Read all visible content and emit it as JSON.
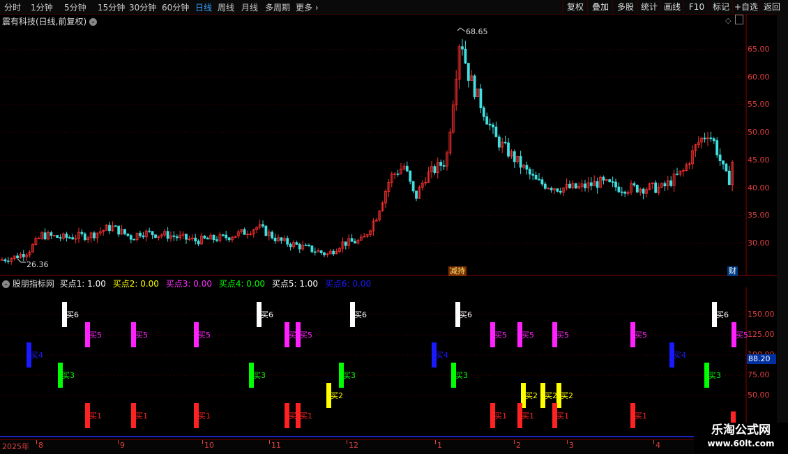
{
  "toolbar": {
    "periods": [
      "分时",
      "1分钟",
      "5分钟",
      "15分钟",
      "30分钟",
      "60分钟",
      "日线",
      "周线",
      "月线",
      "多周期",
      "更多"
    ],
    "active_period": "日线",
    "more_chevron_icon": "chevron-right",
    "buttons": [
      "复权",
      "叠加",
      "多股",
      "统计",
      "画线",
      "F10",
      "标记",
      "+自选",
      "返回"
    ]
  },
  "main_chart": {
    "title": "震有科技(日线,前复权)",
    "title_icon": "chevron-down-circle",
    "max_label": "68.65",
    "min_label": "26.36",
    "y_ticks": [
      "65.00",
      "60.00",
      "55.00",
      "50.00",
      "45.00",
      "40.00",
      "35.00",
      "30.00"
    ],
    "badge_left": "减持",
    "badge_right": "财",
    "colors": {
      "up": "#ff3030",
      "down": "#40e0e0",
      "grid": "#5a0000"
    }
  },
  "indicator": {
    "name": "股朋指标网",
    "params": [
      {
        "label": "买点1: 1.00",
        "color": "#ffffff"
      },
      {
        "label": "买点2: 0.00",
        "color": "#ffff00"
      },
      {
        "label": "买点3: 0.00",
        "color": "#ff33ff"
      },
      {
        "label": "买点4: 0.00",
        "color": "#00ff00"
      },
      {
        "label": "买点5: 1.00",
        "color": "#ffffff"
      },
      {
        "label": "买点6: 0.00",
        "color": "#1a1aff"
      }
    ],
    "y_ticks": [
      "150.00",
      "125.00",
      "100.00",
      "75.00",
      "50.00"
    ],
    "current_value": "88.20",
    "signals": {
      "b6": {
        "label": "买6",
        "color": "#ffffff",
        "level": 150
      },
      "b5": {
        "label": "买5",
        "color": "#ff22ff",
        "level": 125
      },
      "b4": {
        "label": "买4",
        "color": "#1a1aff",
        "level": 100
      },
      "b3": {
        "label": "买3",
        "color": "#00ff00",
        "level": 75
      },
      "b2": {
        "label": "买2",
        "color": "#ffff00",
        "level": 50
      },
      "b1": {
        "label": "买1",
        "color": "#ff2222",
        "level": 25
      }
    }
  },
  "time_axis": {
    "labels": [
      "2025年",
      "8",
      "9",
      "10",
      "11",
      "12",
      "1",
      "2",
      "3",
      "4"
    ]
  },
  "watermark": {
    "line1": "乐淘公式网",
    "line2": "www.60lt.com"
  }
}
